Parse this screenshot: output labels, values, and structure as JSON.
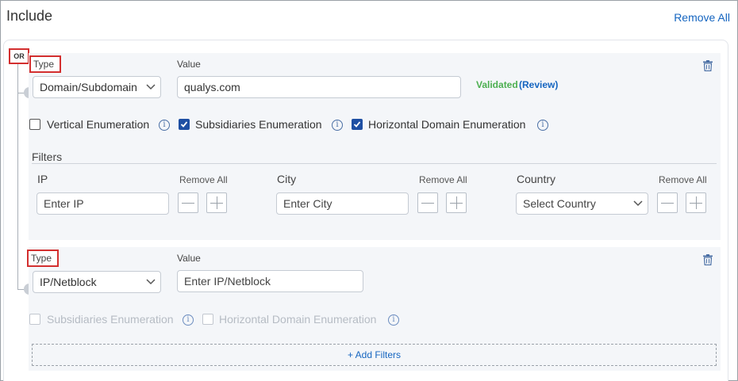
{
  "header": {
    "title": "Include",
    "remove_all_label": "Remove All"
  },
  "operator_badge": "OR",
  "rule1": {
    "type_label": "Type",
    "value_label": "Value",
    "type_selected": "Domain/Subdomain",
    "value": "qualys.com",
    "validated_label": "Validated",
    "review_label": "(Review)",
    "checkboxes": [
      {
        "label": "Vertical Enumeration",
        "checked": false
      },
      {
        "label": "Subsidiaries Enumeration",
        "checked": true
      },
      {
        "label": "Horizontal Domain Enumeration",
        "checked": true
      }
    ],
    "filters": {
      "title": "Filters",
      "fields": [
        {
          "label": "IP",
          "placeholder": "Enter IP",
          "remove_all": "Remove All"
        },
        {
          "label": "City",
          "placeholder": "Enter City",
          "remove_all": "Remove All"
        },
        {
          "label": "Country",
          "placeholder": "Select Country",
          "remove_all": "Remove All"
        }
      ]
    }
  },
  "rule2": {
    "type_label": "Type",
    "value_label": "Value",
    "type_selected": "IP/Netblock",
    "value_placeholder": "Enter IP/Netblock",
    "checkboxes": [
      {
        "label": "Subsidiaries Enumeration",
        "checked": false,
        "disabled": true
      },
      {
        "label": "Horizontal Domain Enumeration",
        "checked": false,
        "disabled": true
      }
    ],
    "add_filters_label": "+ Add Filters"
  },
  "icons": {
    "delete": "trash-icon",
    "info": "info-icon",
    "dropdown": "chevron-down-icon",
    "minus": "minus-icon",
    "plus": "plus-icon"
  },
  "colors": {
    "accent": "#1565c0",
    "validated": "#4caf50",
    "highlight_box": "#d32f2f",
    "checkbox_checked": "#1e4fa3"
  }
}
